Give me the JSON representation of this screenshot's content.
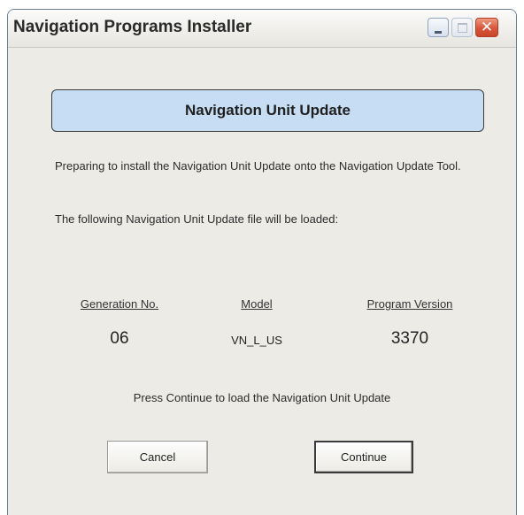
{
  "window": {
    "title": "Navigation Programs Installer",
    "controls": {
      "minimize_icon": "minimize-icon",
      "maximize_icon": "maximize-icon",
      "close_icon": "close-icon",
      "close_glyph": "✕"
    }
  },
  "banner": {
    "title": "Navigation Unit Update"
  },
  "messages": {
    "preparing": "Preparing to install the Navigation Unit Update onto the Navigation Update Tool.",
    "following": "The following Navigation Unit Update file will be loaded:",
    "press_continue": "Press Continue to load the Navigation Unit Update"
  },
  "file_info": {
    "headers": {
      "generation": "Generation No.",
      "model": "Model",
      "program_version": "Program Version"
    },
    "values": {
      "generation": "06",
      "model": "VN_L_US",
      "program_version": "3370"
    }
  },
  "buttons": {
    "cancel": "Cancel",
    "continue": "Continue"
  },
  "colors": {
    "banner_background": "#c6ddf3",
    "dialog_background": "#ecebe6",
    "close_button": "#d7553a"
  }
}
